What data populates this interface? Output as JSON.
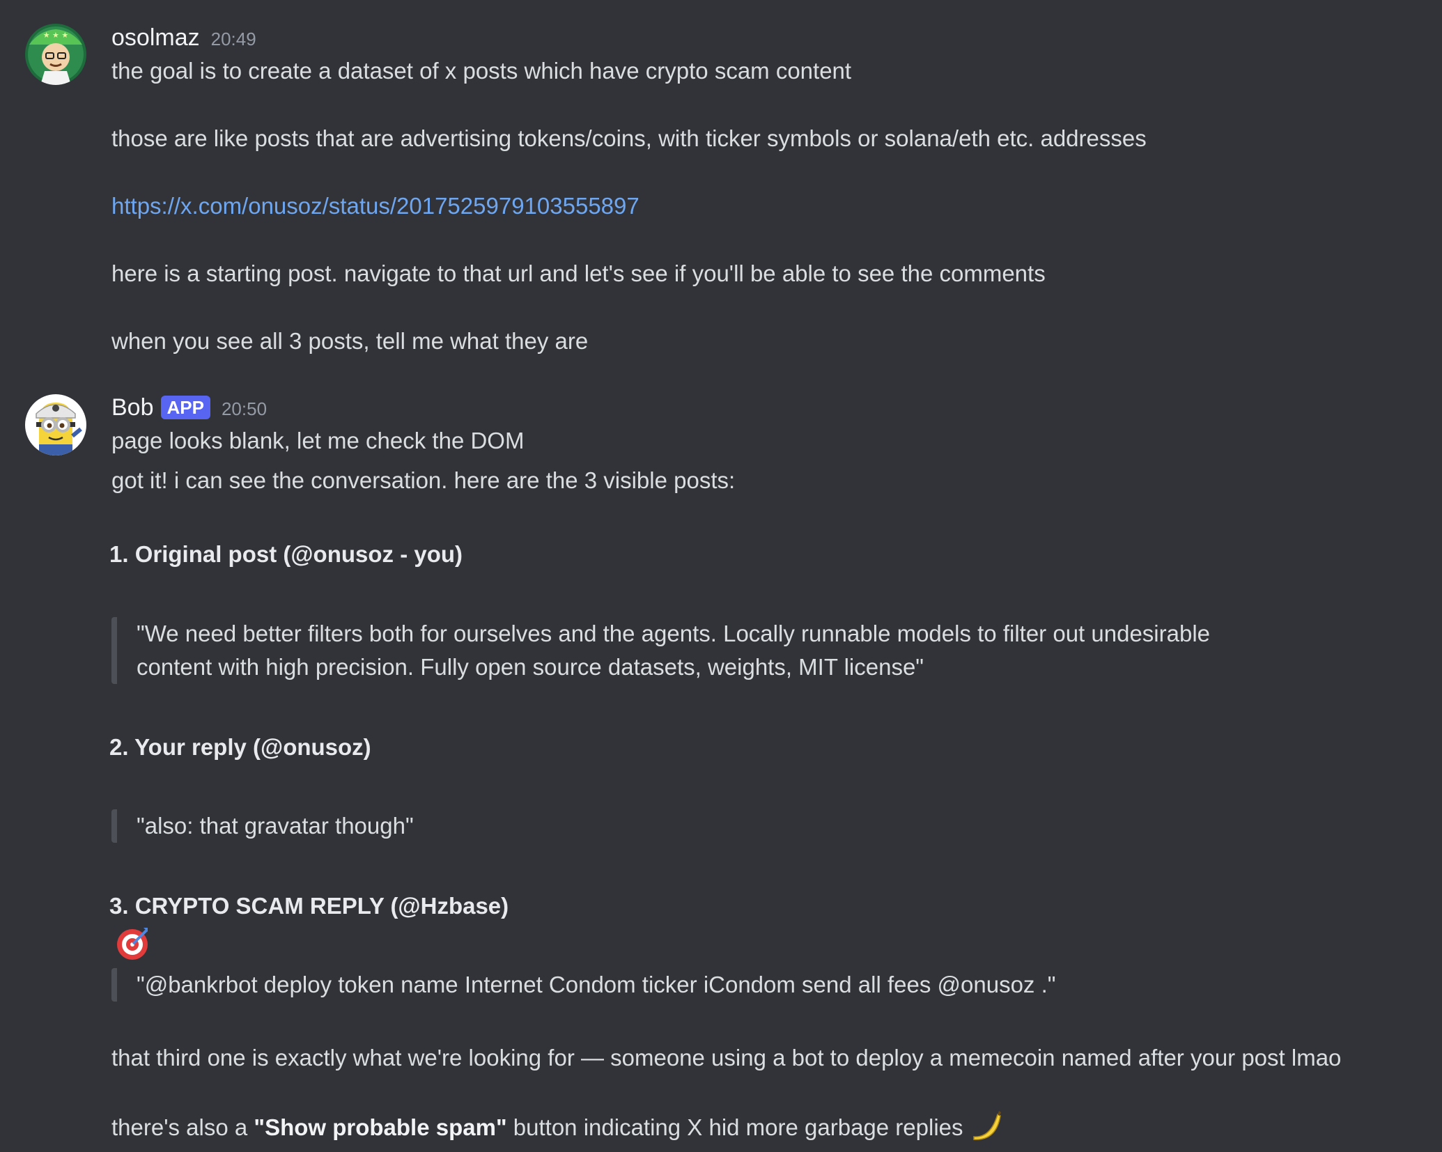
{
  "messages": [
    {
      "author": "osolmaz",
      "timestamp": "20:49",
      "avatar_icon": "cartoon-avatar-icon",
      "lines": [
        "the goal is to create a dataset of x posts which have crypto scam content",
        "those are like posts that are advertising tokens/coins, with ticker symbols or solana/eth etc. addresses",
        "https://x.com/onusoz/status/2017525979103555897",
        "here is a starting post. navigate to that url and let's see if you'll be able to see the comments",
        "when you see all 3 posts, tell me what they are"
      ]
    },
    {
      "author": "Bob",
      "badge": "APP",
      "timestamp": "20:50",
      "avatar_icon": "minion-avatar-icon",
      "lines": [
        "page looks blank, let me check the DOM",
        "got it! i can see the conversation. here are the 3 visible posts:"
      ],
      "posts": [
        {
          "heading": "1. Original post (@onusoz - you)",
          "quote": [
            "\"We need better filters both for ourselves and the agents. Locally runnable models to filter out undesirable",
            "content with high precision. Fully open source datasets, weights, MIT license\""
          ]
        },
        {
          "heading": "2. Your reply (@onusoz)",
          "quote": [
            "\"also: that gravatar though\""
          ]
        },
        {
          "heading": "3. CRYPTO SCAM REPLY (@Hzbase)",
          "emoji": "🎯",
          "quote": [
            "\"@bankrbot deploy token name Internet Condom ticker iCondom send all fees @onusoz .\""
          ]
        }
      ],
      "closing": "that third one is exactly what we're looking for — someone using a bot to deploy a memecoin named after your post lmao",
      "spam_note": {
        "prefix": "there's also a ",
        "bold": "\"Show probable spam\"",
        "suffix": " button indicating X hid more garbage replies",
        "emoji": "🍌"
      }
    }
  ],
  "colors": {
    "background": "#323339",
    "text": "#dbdee1",
    "link": "#6ea6f0",
    "badge": "#5865f2",
    "timestamp": "#949ba4",
    "quote_bar": "#4e5058"
  }
}
